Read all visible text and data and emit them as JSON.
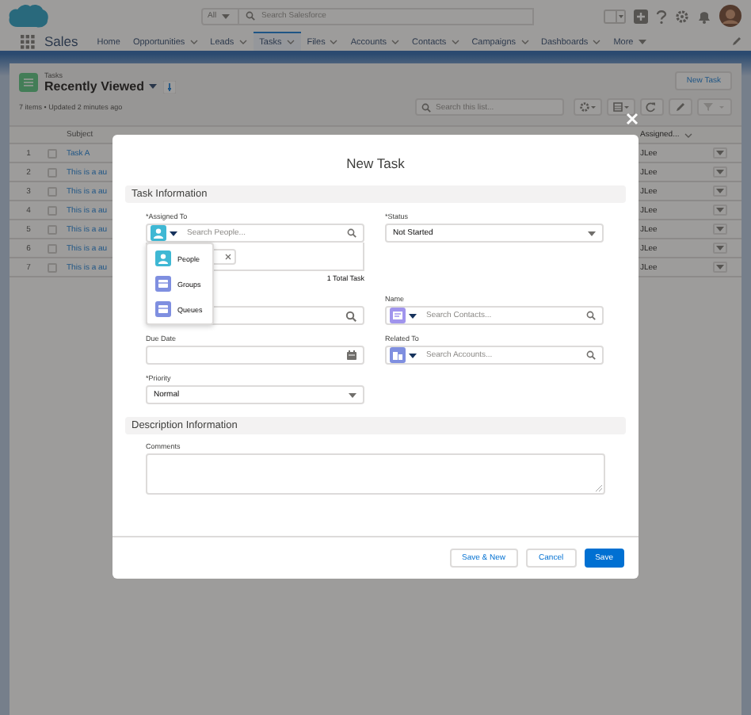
{
  "header": {
    "scope": "All",
    "search_placeholder": "Search Salesforce"
  },
  "nav": {
    "app_name": "Sales",
    "tabs": [
      {
        "label": "Home",
        "has_menu": false,
        "selected": false
      },
      {
        "label": "Opportunities",
        "has_menu": true,
        "selected": false
      },
      {
        "label": "Leads",
        "has_menu": true,
        "selected": false
      },
      {
        "label": "Tasks",
        "has_menu": true,
        "selected": true
      },
      {
        "label": "Files",
        "has_menu": true,
        "selected": false
      },
      {
        "label": "Accounts",
        "has_menu": true,
        "selected": false
      },
      {
        "label": "Contacts",
        "has_menu": true,
        "selected": false
      },
      {
        "label": "Campaigns",
        "has_menu": true,
        "selected": false
      },
      {
        "label": "Dashboards",
        "has_menu": true,
        "selected": false
      },
      {
        "label": "More",
        "has_menu": true,
        "selected": false
      }
    ]
  },
  "list_view": {
    "object": "Tasks",
    "title": "Recently Viewed",
    "summary": "7 items • Updated 2 minutes ago",
    "new_button": "New Task",
    "search_placeholder": "Search this list..."
  },
  "table": {
    "columns": [
      "Subject",
      "Assigned..."
    ],
    "rows": [
      {
        "number": "1",
        "checked": false,
        "subject": "Task A",
        "assigned": "JLee"
      },
      {
        "number": "2",
        "checked": false,
        "subject": "This is a au",
        "assigned": "JLee"
      },
      {
        "number": "3",
        "checked": false,
        "subject": "This is a au",
        "assigned": "JLee"
      },
      {
        "number": "4",
        "checked": false,
        "subject": "This is a au",
        "assigned": "JLee"
      },
      {
        "number": "5",
        "checked": false,
        "subject": "This is a au",
        "assigned": "JLee"
      },
      {
        "number": "6",
        "checked": false,
        "subject": "This is a au",
        "assigned": "JLee"
      },
      {
        "number": "7",
        "checked": false,
        "subject": "This is a au",
        "assigned": "JLee"
      }
    ]
  },
  "modal": {
    "title": "New Task",
    "sections": [
      {
        "title": "Task Information",
        "fields": [
          {
            "kind": "lookup",
            "label": "*Assigned To",
            "icon": {
              "kind": "person",
              "color": "#3fb8d4"
            },
            "placeholder": "Search People...",
            "total": "1 Total Task",
            "menu": [
              {
                "label": "People",
                "color": "#3fb8d4"
              },
              {
                "label": "Groups",
                "color": "#7f8fe0"
              },
              {
                "label": "Queues",
                "color": "#7f8fe0"
              }
            ]
          },
          {
            "kind": "picklist",
            "label": "*Status",
            "value": "Not Started"
          },
          {
            "kind": "search"
          },
          {
            "kind": "lookup",
            "label": "Name",
            "icon": {
              "kind": "contact",
              "color": "#a094ed"
            },
            "placeholder": "Search Contacts..."
          },
          {
            "kind": "date",
            "label": "Due Date"
          },
          {
            "kind": "lookup",
            "label": "Related To",
            "icon": {
              "kind": "account",
              "color": "#7f8fe0"
            },
            "placeholder": "Search Accounts..."
          },
          {
            "kind": "picklist",
            "label": "*Priority",
            "value": "Normal"
          }
        ]
      },
      {
        "title": "Description Information",
        "fields": [
          {
            "kind": "textarea",
            "label": "Comments"
          }
        ]
      }
    ],
    "buttons": [
      {
        "label": "Save & New",
        "primary": false
      },
      {
        "label": "Cancel",
        "primary": false
      },
      {
        "label": "Save",
        "primary": true
      }
    ]
  }
}
